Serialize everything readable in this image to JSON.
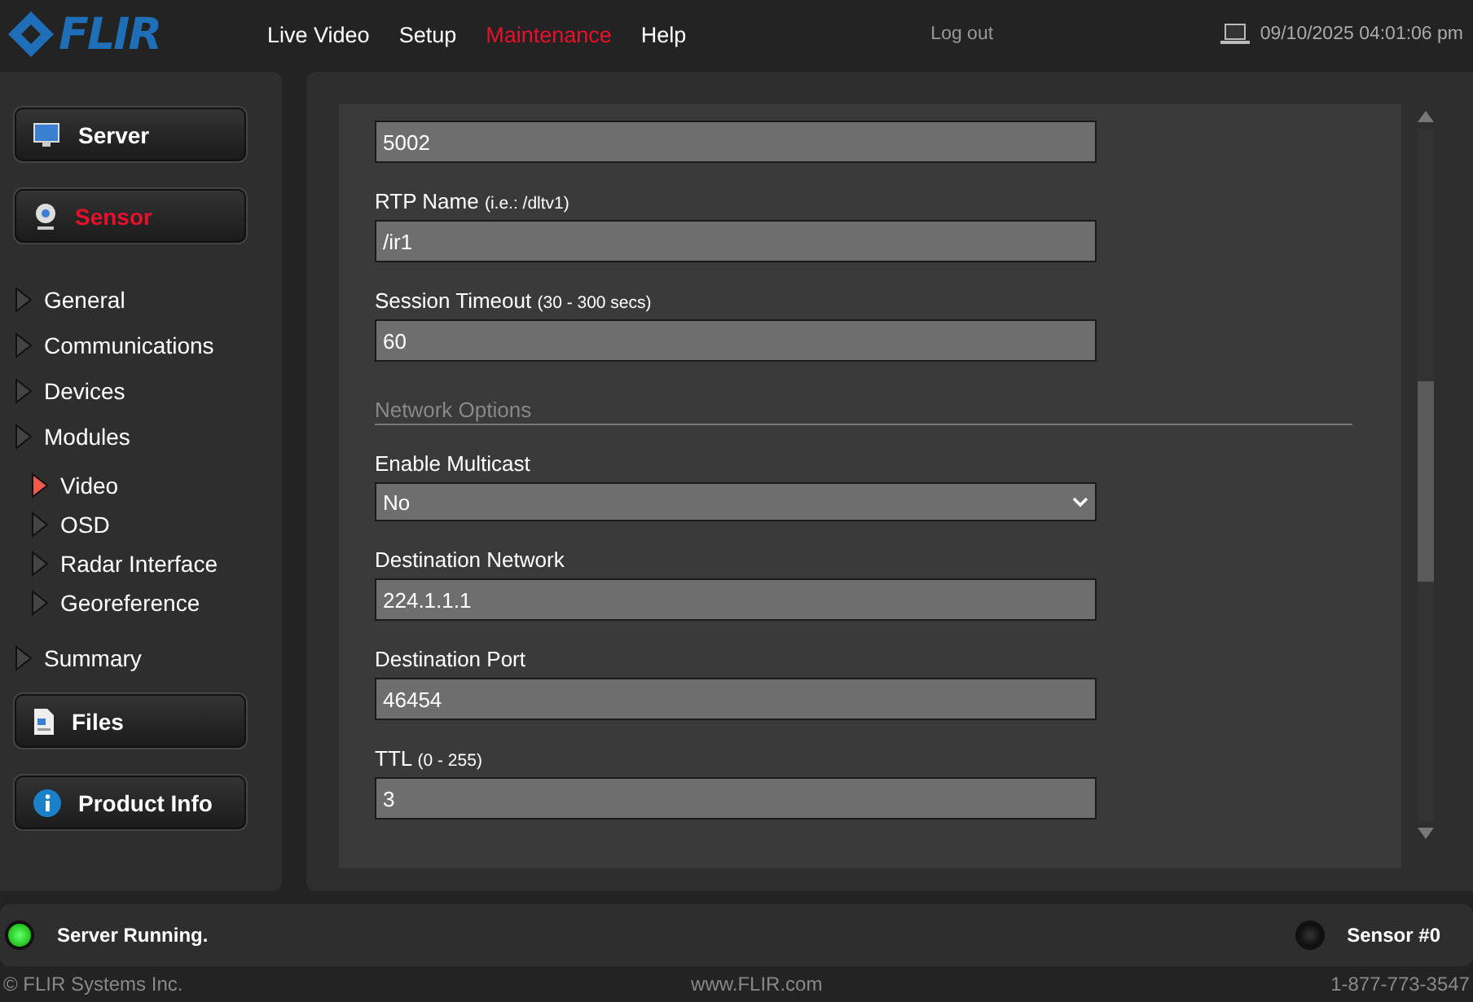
{
  "header": {
    "logo": "FLIR",
    "nav": [
      {
        "label": "Live Video",
        "selected": false
      },
      {
        "label": "Setup",
        "selected": false
      },
      {
        "label": "Maintenance",
        "selected": true
      },
      {
        "label": "Help",
        "selected": false
      }
    ],
    "logout": "Log out",
    "datetime": "09/10/2025 04:01:06 pm"
  },
  "sidebar": {
    "sections": [
      {
        "label": "Server",
        "selected": false
      },
      {
        "label": "Sensor",
        "selected": true,
        "items": [
          {
            "label": "General",
            "selected": false
          },
          {
            "label": "Communications",
            "selected": false
          },
          {
            "label": "Devices",
            "selected": false
          },
          {
            "label": "Modules",
            "selected": false,
            "children": [
              {
                "label": "Video",
                "selected": true
              },
              {
                "label": "OSD",
                "selected": false
              },
              {
                "label": "Radar Interface",
                "selected": false
              },
              {
                "label": "Georeference",
                "selected": false
              }
            ]
          },
          {
            "label": "Summary",
            "selected": false
          }
        ]
      },
      {
        "label": "Files",
        "selected": false
      },
      {
        "label": "Product Info",
        "selected": false
      }
    ]
  },
  "form": {
    "rows": [
      {
        "kind": "field",
        "value": "5002"
      },
      {
        "kind": "field",
        "label": "RTP Name",
        "hint": "(i.e.: /dltv1)",
        "value": "/ir1"
      },
      {
        "kind": "field",
        "label": "Session Timeout",
        "hint": "(30 - 300 secs)",
        "value": "60"
      },
      {
        "kind": "heading",
        "label": "Network Options"
      },
      {
        "kind": "select",
        "label": "Enable Multicast",
        "value": "No"
      },
      {
        "kind": "field",
        "label": "Destination Network",
        "value": "224.1.1.1"
      },
      {
        "kind": "field",
        "label": "Destination Port",
        "value": "46454"
      },
      {
        "kind": "field",
        "label": "TTL",
        "hint": "(0 - 255)",
        "value": "3"
      }
    ]
  },
  "status_bar": {
    "indicators": [
      {
        "label": "Server Running.",
        "on": true
      },
      {
        "label": "Sensor #0",
        "on": false
      }
    ]
  },
  "footer": {
    "copyright": "© FLIR Systems Inc.",
    "website": "www.FLIR.com",
    "phone": "1-877-773-3547"
  }
}
